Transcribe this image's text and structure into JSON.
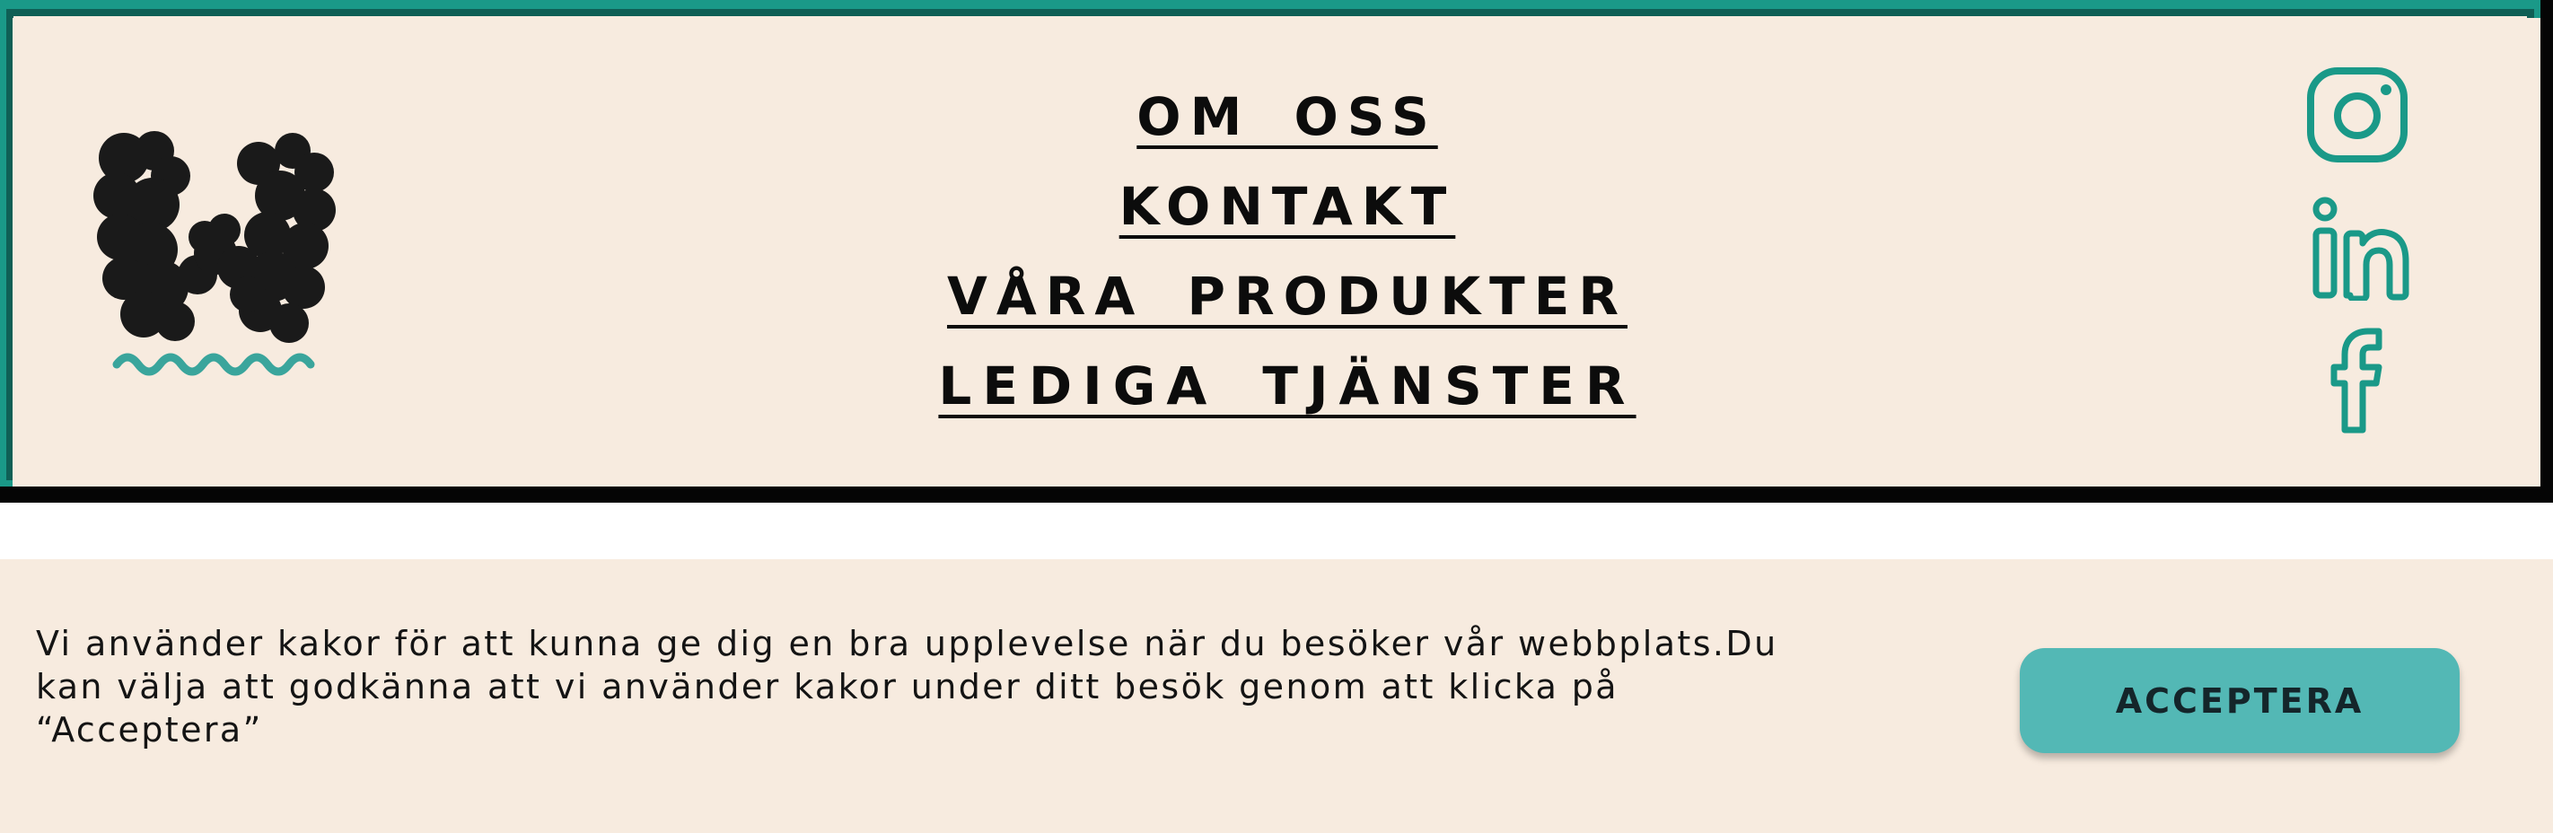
{
  "nav": {
    "items": [
      {
        "label": "OM OSS"
      },
      {
        "label": "KONTAKT"
      },
      {
        "label": "VÅRA PRODUKTER"
      },
      {
        "label": "LEDIGA TJÄNSTER"
      }
    ]
  },
  "logo": {
    "icon": "w-logo-icon",
    "color": "#1a1a1a",
    "wave_color": "#3aa59c"
  },
  "social": {
    "icons": [
      "instagram-icon",
      "linkedin-icon",
      "facebook-icon"
    ],
    "color": "#1a9988"
  },
  "cookie": {
    "text": "Vi använder kakor för att kunna ge dig en bra upplevelse när du besöker vår webbplats.Du kan välja att godkänna att vi använder kakor under ditt besök genom att klicka på “Acceptera”",
    "accept_label": "ACCEPTERA",
    "button_color": "#53b8b5"
  },
  "theme": {
    "accent": "#1a9988",
    "background": "#f7ebdf"
  }
}
